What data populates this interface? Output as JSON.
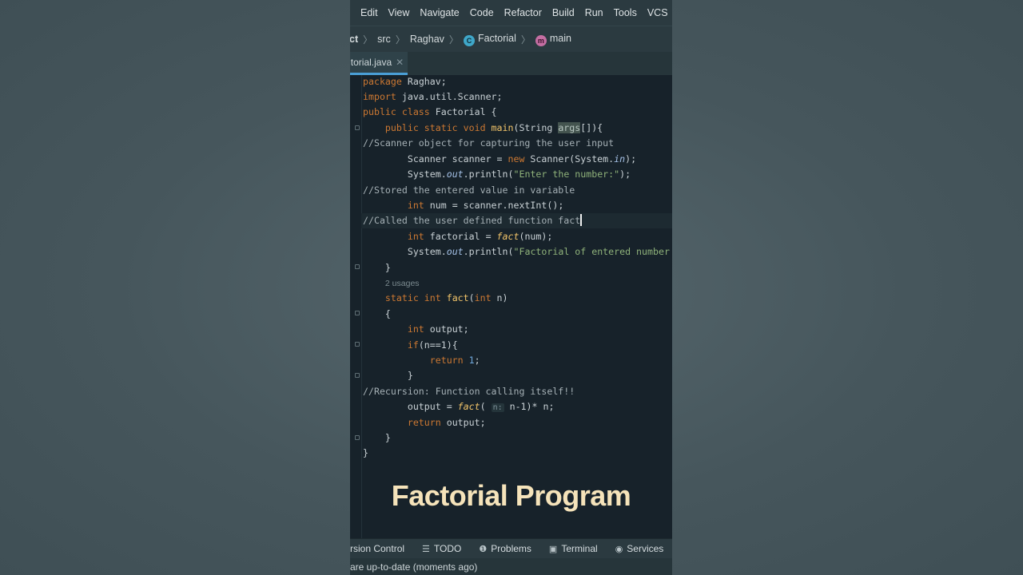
{
  "menu": [
    "Edit",
    "View",
    "Navigate",
    "Code",
    "Refactor",
    "Build",
    "Run",
    "Tools",
    "VCS"
  ],
  "breadcrumb": {
    "project": "ct",
    "src": "src",
    "package": "Raghav",
    "class_icon": "C",
    "class": "Factorial",
    "method_icon": "m",
    "method": "main"
  },
  "tab": {
    "label": "torial.java",
    "close_glyph": "✕"
  },
  "code": {
    "l1_kw": "package",
    "l1_rest": " Raghav;",
    "l2_kw": "import",
    "l2_rest": " java.util.Scanner;",
    "l3_kw": "public class",
    "l3_name": " Factorial",
    "l3_rest": " {",
    "l4_kw": "public static void",
    "l4_fn": " main",
    "l4_a": "(String ",
    "l4_args": "args",
    "l4_b": "[]){",
    "l5": "//Scanner object for capturing the user input",
    "l6_a": "Scanner scanner = ",
    "l6_kw": "new",
    "l6_b": " Scanner(System.",
    "l6_in": "in",
    "l6_c": ");",
    "l7_a": "System.",
    "l7_out": "out",
    "l7_b": ".println(",
    "l7_str": "\"Enter the number:\"",
    "l7_c": ");",
    "l8": "//Stored the entered value in variable",
    "l9_kw": "int",
    "l9_rest": " num = scanner.nextInt();",
    "l10": "//Called the user defined function fact",
    "l11_kw": "int",
    "l11_a": " factorial = ",
    "l11_fn": "fact",
    "l11_b": "(num);",
    "l12_a": "System.",
    "l12_out": "out",
    "l12_b": ".println(",
    "l12_str": "\"Factorial of entered number",
    "l13": "}",
    "usages": "2 usages",
    "l15_kw": "static int",
    "l15_fn": " fact",
    "l15_a": "(",
    "l15_kw2": "int",
    "l15_b": " n)",
    "l16": "{",
    "l17_kw": "int",
    "l17_rest": " output;",
    "l18_kw": "if",
    "l18_rest": "(n==1){",
    "l19_kw": "return",
    "l19_num": " 1",
    "l19_rest": ";",
    "l20": "}",
    "l21": "//Recursion: Function calling itself!!",
    "l22_a": "output = ",
    "l22_fn": "fact",
    "l22_b": "( ",
    "l22_hint": "n:",
    "l22_c": " n-1)* n;",
    "l23_kw": "return",
    "l23_rest": " output;",
    "l24": "}",
    "l25": "}"
  },
  "caption": "Factorial Program",
  "toolwindows": {
    "version_control": "rsion Control",
    "todo": "TODO",
    "problems": "Problems",
    "terminal": "Terminal",
    "services": "Services"
  },
  "status": "are up-to-date (moments ago)"
}
